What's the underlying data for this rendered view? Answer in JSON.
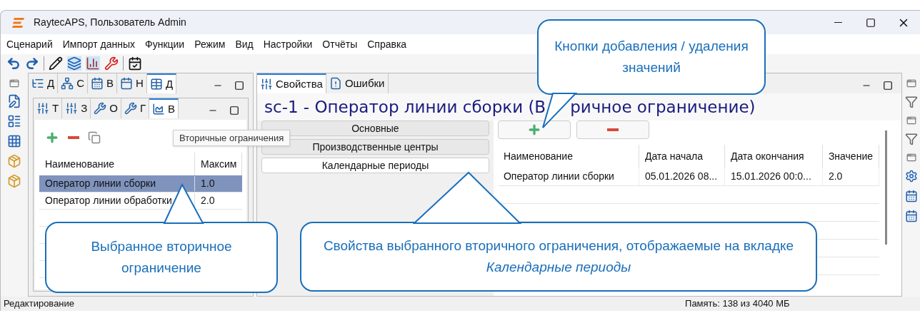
{
  "window": {
    "title": "RaytecAPS, Пользователь Admin"
  },
  "menu": [
    "Сценарий",
    "Импорт данных",
    "Функции",
    "Режим",
    "Вид",
    "Настройки",
    "Отчёты",
    "Справка"
  ],
  "left_panel": {
    "tabs": [
      {
        "label": "Д",
        "selected": false
      },
      {
        "label": "С",
        "selected": false
      },
      {
        "label": "В",
        "selected": false
      },
      {
        "label": "Н",
        "selected": false
      },
      {
        "label": "Д",
        "selected": true
      }
    ],
    "inner_tabs": [
      {
        "label": "Т",
        "selected": false
      },
      {
        "label": "З",
        "selected": false
      },
      {
        "label": "О",
        "selected": false
      },
      {
        "label": "Г",
        "selected": false
      },
      {
        "label": "В",
        "selected": true
      }
    ],
    "tooltip": "Вторичные ограничения",
    "table": {
      "columns": [
        "Наименование",
        "Максим"
      ],
      "rows": [
        {
          "cells": [
            "Оператор линии сборки",
            "1.0"
          ],
          "selected": true
        },
        {
          "cells": [
            "Оператор линии обработки",
            "2.0"
          ],
          "selected": false
        }
      ]
    }
  },
  "main_panel": {
    "tabs": [
      {
        "label": "Свойства",
        "selected": true
      },
      {
        "label": "Ошибки",
        "selected": false
      }
    ],
    "heading": [
      "sc-1 - Оператор линии сборки (В",
      "ричное ограничение)"
    ],
    "sections": [
      {
        "label": "Основные",
        "selected": false
      },
      {
        "label": "Производственные центры",
        "selected": false
      },
      {
        "label": "Календарные периоды",
        "selected": true
      }
    ],
    "table": {
      "columns": [
        "Наименование",
        "Дата начала",
        "Дата окончания",
        "Значение"
      ],
      "rows": [
        {
          "cells": [
            "Оператор линии сборки",
            "05.01.2026 08...",
            "15.01.2026 00:0...",
            "2.0"
          ]
        }
      ]
    }
  },
  "callouts": [
    {
      "text": "Кнопки добавления / удаления значений"
    },
    {
      "text": "Выбранное вторичное ограничение"
    },
    {
      "text": "Свойства выбранного вторичного ограничения, отображаемые на вкладке *Календарные периоды*"
    }
  ],
  "status_bar": {
    "mode": "Редактирование",
    "memory": "Память: 138 из 4040 МБ"
  }
}
